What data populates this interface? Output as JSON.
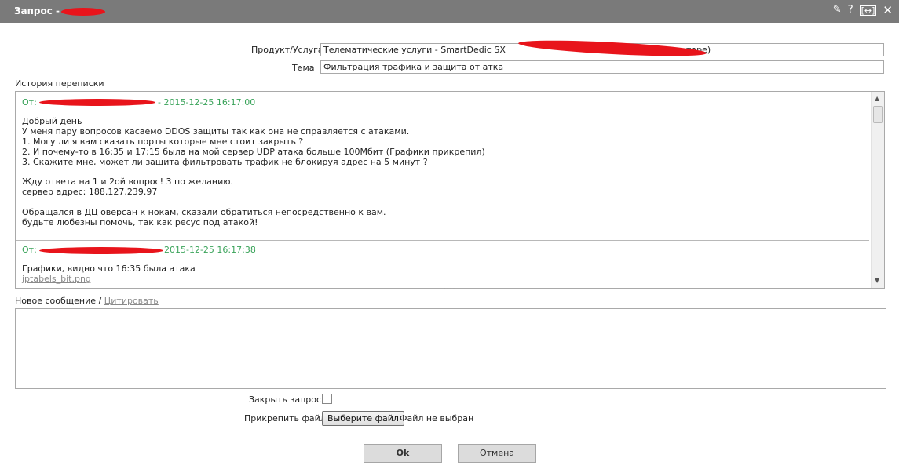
{
  "window": {
    "title": "Запрос -",
    "icons": [
      "pin-icon",
      "help-icon",
      "maximize-icon",
      "close-icon"
    ],
    "icon_glyphs": {
      "pin": "✎",
      "help": "?",
      "maximize": "[↔]",
      "close": "✕"
    }
  },
  "form": {
    "product_label": "Продукт/Услуга",
    "product_value": "Телематические услуги  - SmartDedic SX",
    "product_value_tail": "тарe)",
    "topic_label": "Тема",
    "topic_value": "Фильтрация трафика и защита от атка"
  },
  "history": {
    "label": "История переписки",
    "messages": [
      {
        "from_prefix": "От:",
        "datetime": "- 2015-12-25 16:17:00",
        "lines": [
          "Добрый день",
          "У меня пару вопросов касаемо DDOS защиты так как она не справляется с атаками.",
          "1. Могу ли я вам сказать порты которые мне стоит закрыть ?",
          "2. И почему-то в 16:35 и 17:15 была на мой сервер UDP атака больше 100Мбит (Графики прикрепил)",
          "3. Скажите мне, может ли защита фильтровать трафик не блокируя адрес на 5 минут ?",
          "",
          "Жду ответа на 1 и 2ой вопрос! 3 по желанию.",
          "сервер адрес: 188.127.239.97",
          "",
          "Обращался в ДЦ оверсан к нокам, сказали обратиться непосредственно к вам.",
          "будьте любезны помочь, так как ресус под атакой!"
        ]
      },
      {
        "from_prefix": "От:",
        "datetime": "2015-12-25 16:17:38",
        "lines": [
          "Графики, видно что 16:35 была атака"
        ],
        "attachment": "jptabels_bit.png"
      }
    ],
    "grip": "....",
    "scroll_up": "▲",
    "scroll_down": "▼"
  },
  "new_message": {
    "label": "Новое сообщение /",
    "cite_link": "Цитировать",
    "value": ""
  },
  "options": {
    "close_label": "Закрыть запрос",
    "attach_label": "Прикрепить файл",
    "choose_file_button": "Выберите файл",
    "no_file_text": "Файл не выбран"
  },
  "buttons": {
    "ok": "Ok",
    "cancel": "Отмена"
  },
  "colors": {
    "titlebar": "#7a7a7a",
    "meta_green": "#3aa35a",
    "redaction": "#e8141b"
  }
}
